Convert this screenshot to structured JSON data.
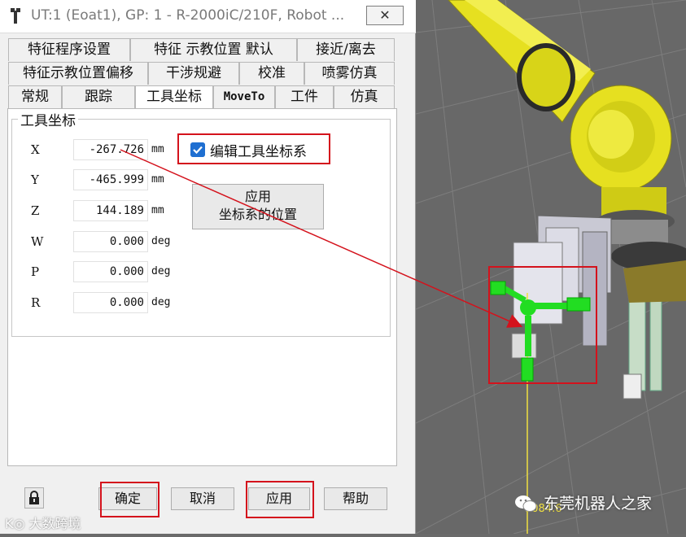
{
  "window": {
    "title": "UT:1  (Eoat1), GP: 1 - R-2000iC/210F, Robot ...",
    "close_label": "✕"
  },
  "tabs": {
    "row1": [
      "特征程序设置",
      "特征 示教位置 默认",
      "接近/离去"
    ],
    "row2": [
      "特征示教位置偏移",
      "干涉规避",
      "校准",
      "喷雾仿真"
    ],
    "row3": [
      "常规",
      "跟踪",
      "工具坐标",
      "MoveTo",
      "工件",
      "仿真"
    ],
    "active": "工具坐标"
  },
  "group": {
    "title": "工具坐标",
    "fields": [
      {
        "label": "X",
        "value": "-267.726",
        "unit": "mm"
      },
      {
        "label": "Y",
        "value": "-465.999",
        "unit": "mm"
      },
      {
        "label": "Z",
        "value": "144.189",
        "unit": "mm"
      },
      {
        "label": "W",
        "value": "0.000",
        "unit": "deg"
      },
      {
        "label": "P",
        "value": "0.000",
        "unit": "deg"
      },
      {
        "label": "R",
        "value": "0.000",
        "unit": "deg"
      }
    ],
    "edit_checkbox": {
      "label": "编辑工具坐标系",
      "checked": true
    },
    "apply_position_button": {
      "line1": "应用",
      "line2": "坐标系的位置"
    }
  },
  "footer": {
    "ok": "确定",
    "cancel": "取消",
    "apply": "应用",
    "help": "帮助"
  },
  "viewport": {
    "coordinate_readout": "1084.6"
  },
  "watermarks": {
    "left": "大数跨境",
    "right": "东莞机器人之家"
  },
  "colors": {
    "highlight_red": "#d4121c",
    "robot_yellow": "#e6e020",
    "frame_green": "#22dd22",
    "checkbox_blue": "#1f6fd1"
  }
}
